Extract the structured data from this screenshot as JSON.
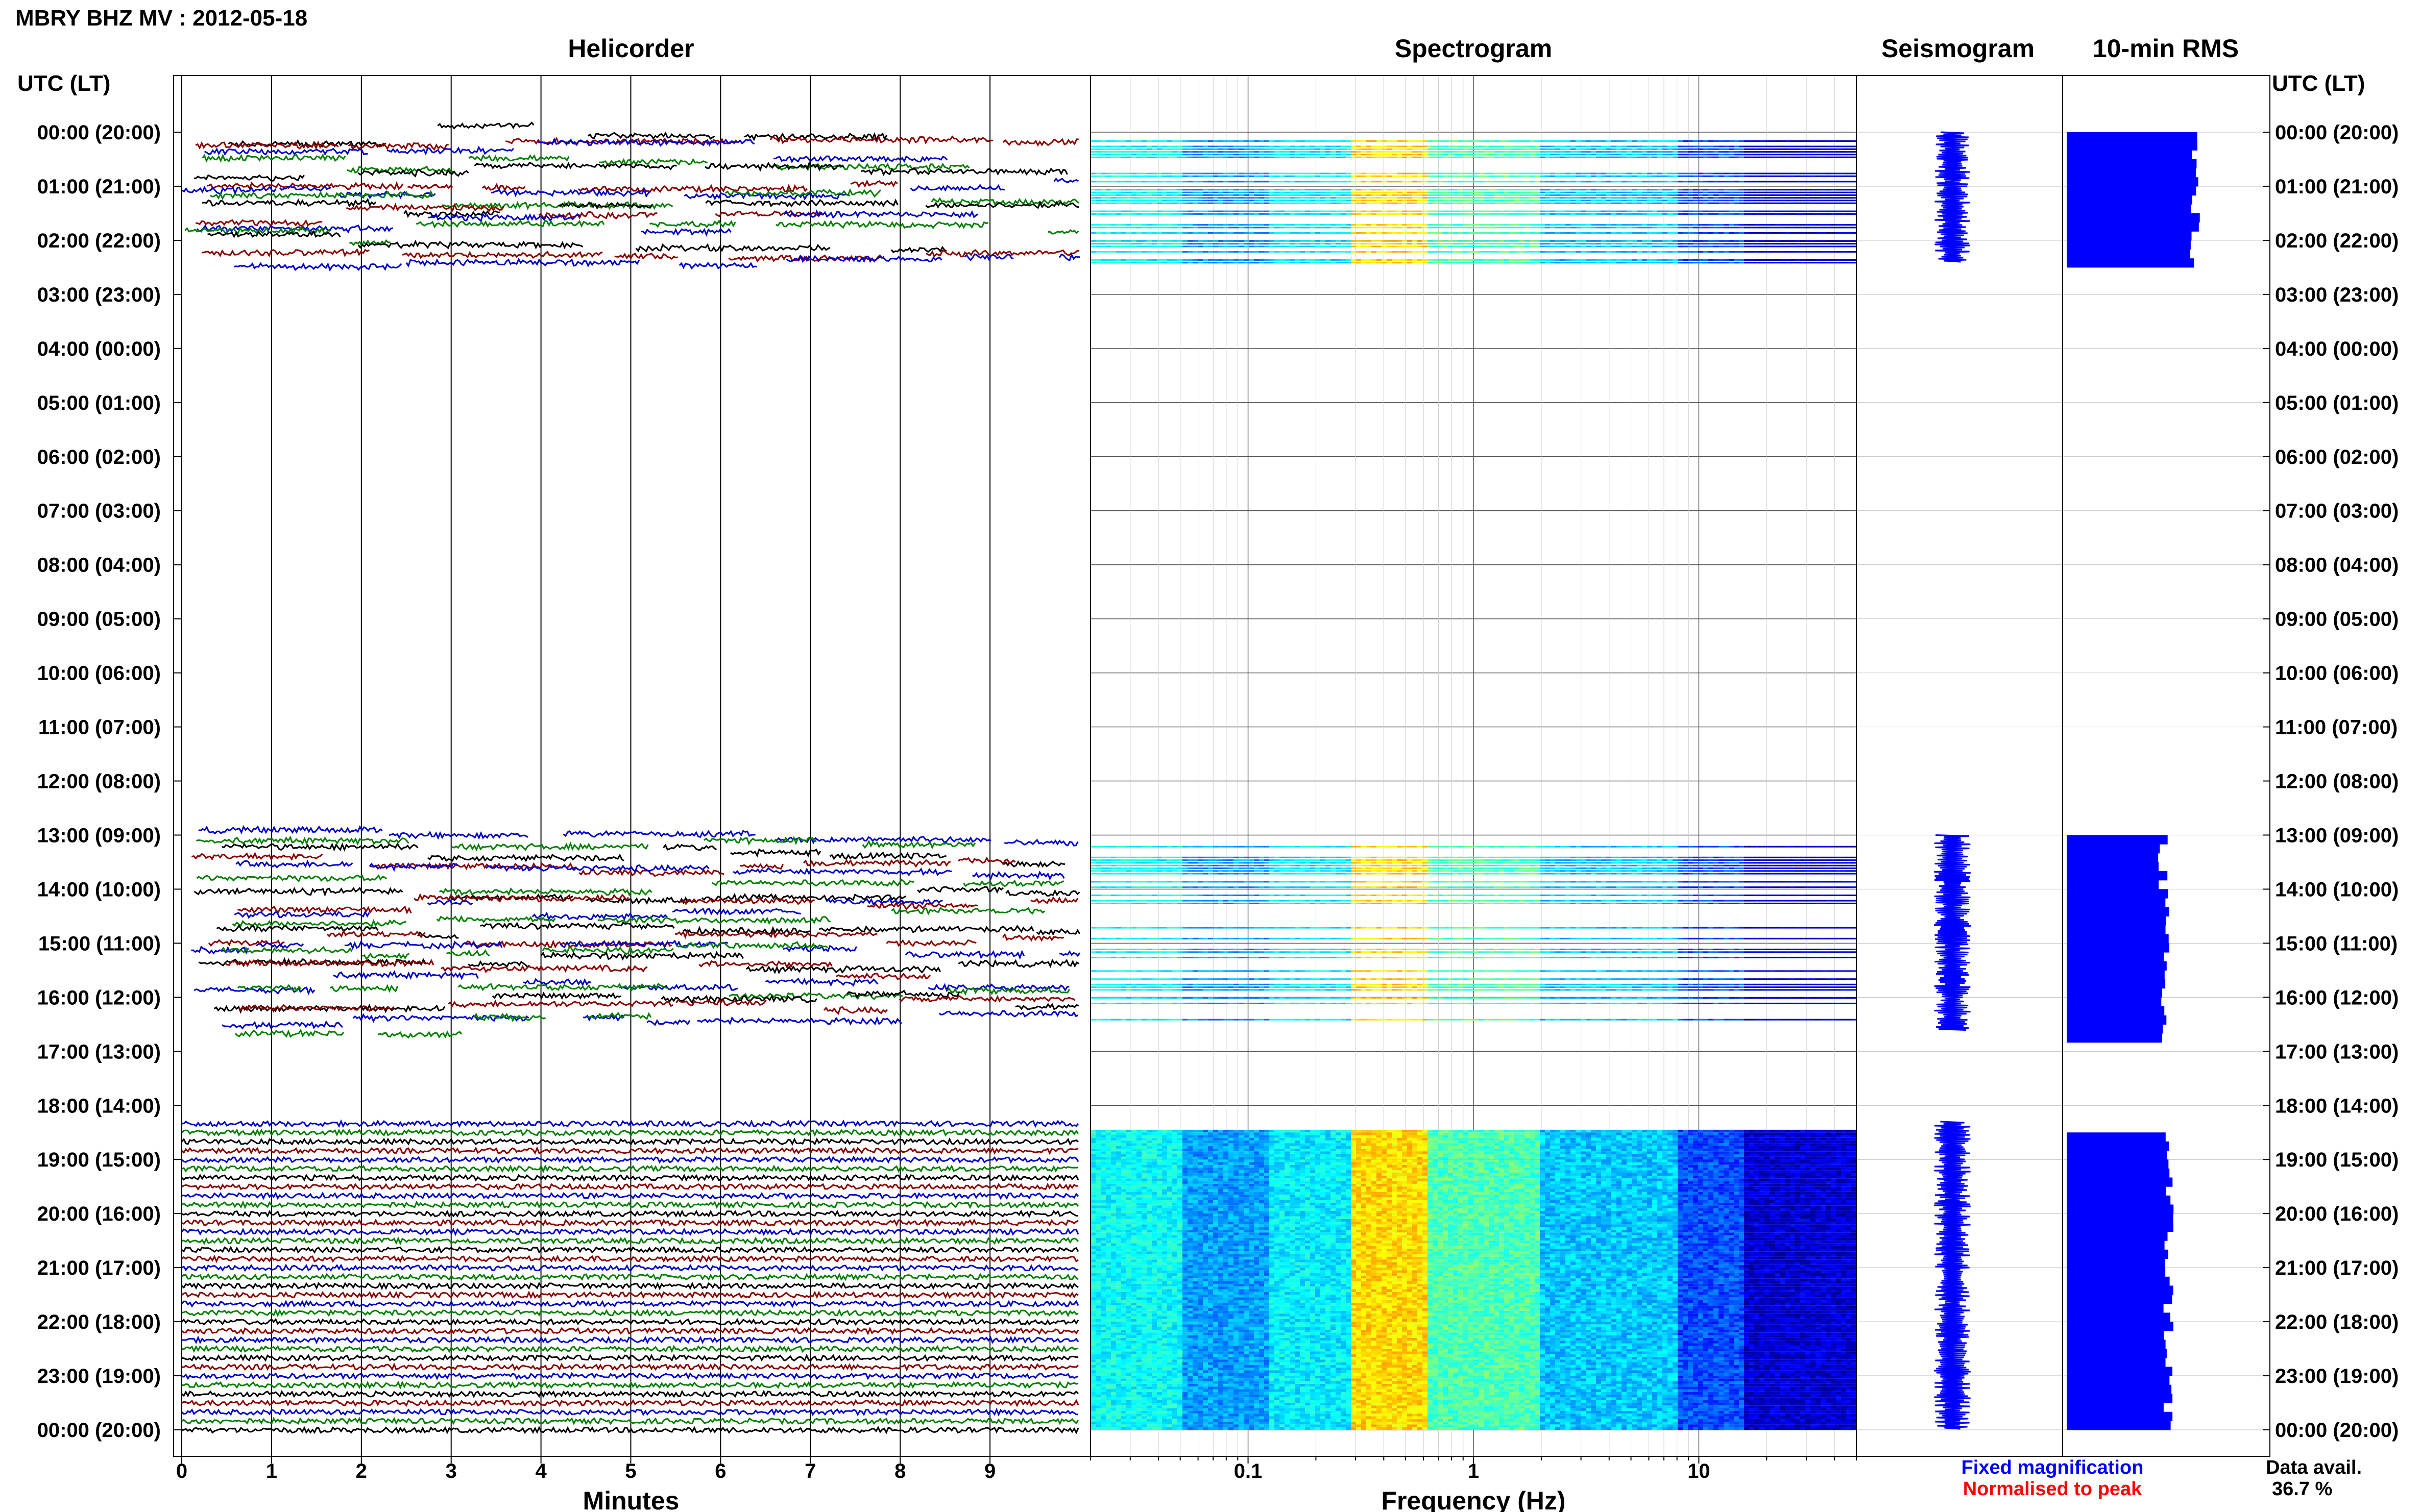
{
  "title": "MBRY BHZ MV : 2012-05-18",
  "left_axis_header": "UTC (LT)",
  "right_axis_header": "UTC (LT)",
  "panels": {
    "helicorder": "Helicorder",
    "spectrogram": "Spectrogram",
    "seismogram": "Seismogram",
    "rms": "10-min RMS"
  },
  "hour_labels": [
    "00:00 (20:00)",
    "01:00 (21:00)",
    "02:00 (22:00)",
    "03:00 (23:00)",
    "04:00 (00:00)",
    "05:00 (01:00)",
    "06:00 (02:00)",
    "07:00 (03:00)",
    "08:00 (04:00)",
    "09:00 (05:00)",
    "10:00 (06:00)",
    "11:00 (07:00)",
    "12:00 (08:00)",
    "13:00 (09:00)",
    "14:00 (10:00)",
    "15:00 (11:00)",
    "16:00 (12:00)",
    "17:00 (13:00)",
    "18:00 (14:00)",
    "19:00 (15:00)",
    "20:00 (16:00)",
    "21:00 (17:00)",
    "22:00 (18:00)",
    "23:00 (19:00)",
    "00:00 (20:00)"
  ],
  "helicorder_xlabel": "Minutes",
  "helicorder_ticks": [
    "0",
    "1",
    "2",
    "3",
    "4",
    "5",
    "6",
    "7",
    "8",
    "9"
  ],
  "spectrogram_xlabel": "Frequency (Hz)",
  "spectrogram_ticks": [
    "0.1",
    "1",
    "10"
  ],
  "legend": {
    "fixed": "Fixed magnification",
    "normalised": "Normalised to peak",
    "fixed_color": "#0000ff",
    "normalised_color": "#ff0000"
  },
  "data_avail_label": "Data avail.",
  "data_avail_value": "36.7 %",
  "chart_data": {
    "type": "helicorder-spectrogram",
    "date": "2012-05-18",
    "time_range_utc_hours": [
      0,
      24
    ],
    "helicorder": {
      "x_range_minutes": [
        0,
        10
      ],
      "trace_colors": [
        "#000000",
        "#8b0000",
        "#0000cd",
        "#008000"
      ],
      "data_segments_utc_hours": [
        [
          0.0,
          2.4
        ],
        [
          13.0,
          16.6
        ],
        [
          18.3,
          24.0
        ]
      ]
    },
    "spectrogram": {
      "freq_range_hz": [
        0.02,
        50
      ],
      "x_scale": "log",
      "colormap": "jet"
    },
    "rms": {
      "segments_utc_hours": [
        [
          0.0,
          2.5
        ],
        [
          13.0,
          16.8
        ],
        [
          18.5,
          24.0
        ]
      ],
      "color": "#0000ff"
    },
    "data_availability_percent": 36.7
  }
}
